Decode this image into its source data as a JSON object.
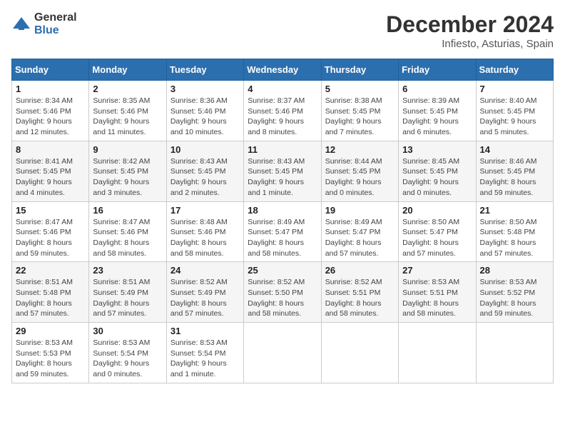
{
  "header": {
    "logo_line1": "General",
    "logo_line2": "Blue",
    "month": "December 2024",
    "location": "Infiesto, Asturias, Spain"
  },
  "weekdays": [
    "Sunday",
    "Monday",
    "Tuesday",
    "Wednesday",
    "Thursday",
    "Friday",
    "Saturday"
  ],
  "weeks": [
    [
      {
        "day": "1",
        "detail": "Sunrise: 8:34 AM\nSunset: 5:46 PM\nDaylight: 9 hours\nand 12 minutes."
      },
      {
        "day": "2",
        "detail": "Sunrise: 8:35 AM\nSunset: 5:46 PM\nDaylight: 9 hours\nand 11 minutes."
      },
      {
        "day": "3",
        "detail": "Sunrise: 8:36 AM\nSunset: 5:46 PM\nDaylight: 9 hours\nand 10 minutes."
      },
      {
        "day": "4",
        "detail": "Sunrise: 8:37 AM\nSunset: 5:46 PM\nDaylight: 9 hours\nand 8 minutes."
      },
      {
        "day": "5",
        "detail": "Sunrise: 8:38 AM\nSunset: 5:45 PM\nDaylight: 9 hours\nand 7 minutes."
      },
      {
        "day": "6",
        "detail": "Sunrise: 8:39 AM\nSunset: 5:45 PM\nDaylight: 9 hours\nand 6 minutes."
      },
      {
        "day": "7",
        "detail": "Sunrise: 8:40 AM\nSunset: 5:45 PM\nDaylight: 9 hours\nand 5 minutes."
      }
    ],
    [
      {
        "day": "8",
        "detail": "Sunrise: 8:41 AM\nSunset: 5:45 PM\nDaylight: 9 hours\nand 4 minutes."
      },
      {
        "day": "9",
        "detail": "Sunrise: 8:42 AM\nSunset: 5:45 PM\nDaylight: 9 hours\nand 3 minutes."
      },
      {
        "day": "10",
        "detail": "Sunrise: 8:43 AM\nSunset: 5:45 PM\nDaylight: 9 hours\nand 2 minutes."
      },
      {
        "day": "11",
        "detail": "Sunrise: 8:43 AM\nSunset: 5:45 PM\nDaylight: 9 hours\nand 1 minute."
      },
      {
        "day": "12",
        "detail": "Sunrise: 8:44 AM\nSunset: 5:45 PM\nDaylight: 9 hours\nand 0 minutes."
      },
      {
        "day": "13",
        "detail": "Sunrise: 8:45 AM\nSunset: 5:45 PM\nDaylight: 9 hours\nand 0 minutes."
      },
      {
        "day": "14",
        "detail": "Sunrise: 8:46 AM\nSunset: 5:45 PM\nDaylight: 8 hours\nand 59 minutes."
      }
    ],
    [
      {
        "day": "15",
        "detail": "Sunrise: 8:47 AM\nSunset: 5:46 PM\nDaylight: 8 hours\nand 59 minutes."
      },
      {
        "day": "16",
        "detail": "Sunrise: 8:47 AM\nSunset: 5:46 PM\nDaylight: 8 hours\nand 58 minutes."
      },
      {
        "day": "17",
        "detail": "Sunrise: 8:48 AM\nSunset: 5:46 PM\nDaylight: 8 hours\nand 58 minutes."
      },
      {
        "day": "18",
        "detail": "Sunrise: 8:49 AM\nSunset: 5:47 PM\nDaylight: 8 hours\nand 58 minutes."
      },
      {
        "day": "19",
        "detail": "Sunrise: 8:49 AM\nSunset: 5:47 PM\nDaylight: 8 hours\nand 57 minutes."
      },
      {
        "day": "20",
        "detail": "Sunrise: 8:50 AM\nSunset: 5:47 PM\nDaylight: 8 hours\nand 57 minutes."
      },
      {
        "day": "21",
        "detail": "Sunrise: 8:50 AM\nSunset: 5:48 PM\nDaylight: 8 hours\nand 57 minutes."
      }
    ],
    [
      {
        "day": "22",
        "detail": "Sunrise: 8:51 AM\nSunset: 5:48 PM\nDaylight: 8 hours\nand 57 minutes."
      },
      {
        "day": "23",
        "detail": "Sunrise: 8:51 AM\nSunset: 5:49 PM\nDaylight: 8 hours\nand 57 minutes."
      },
      {
        "day": "24",
        "detail": "Sunrise: 8:52 AM\nSunset: 5:49 PM\nDaylight: 8 hours\nand 57 minutes."
      },
      {
        "day": "25",
        "detail": "Sunrise: 8:52 AM\nSunset: 5:50 PM\nDaylight: 8 hours\nand 58 minutes."
      },
      {
        "day": "26",
        "detail": "Sunrise: 8:52 AM\nSunset: 5:51 PM\nDaylight: 8 hours\nand 58 minutes."
      },
      {
        "day": "27",
        "detail": "Sunrise: 8:53 AM\nSunset: 5:51 PM\nDaylight: 8 hours\nand 58 minutes."
      },
      {
        "day": "28",
        "detail": "Sunrise: 8:53 AM\nSunset: 5:52 PM\nDaylight: 8 hours\nand 59 minutes."
      }
    ],
    [
      {
        "day": "29",
        "detail": "Sunrise: 8:53 AM\nSunset: 5:53 PM\nDaylight: 8 hours\nand 59 minutes."
      },
      {
        "day": "30",
        "detail": "Sunrise: 8:53 AM\nSunset: 5:54 PM\nDaylight: 9 hours\nand 0 minutes."
      },
      {
        "day": "31",
        "detail": "Sunrise: 8:53 AM\nSunset: 5:54 PM\nDaylight: 9 hours\nand 1 minute."
      },
      null,
      null,
      null,
      null
    ]
  ]
}
